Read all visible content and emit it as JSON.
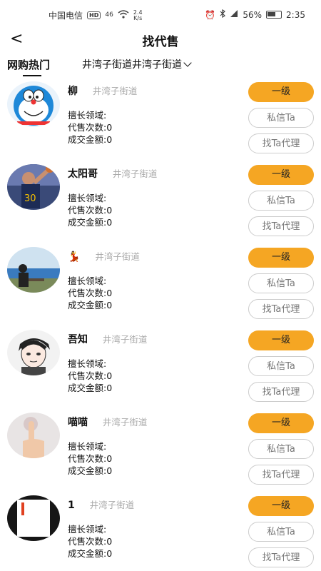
{
  "statusbar": {
    "carrier": "中国电信",
    "hd": "HD",
    "signal": "46",
    "speed_value": "2.4",
    "speed_unit": "K/s",
    "battery": "56%",
    "time": "2:35"
  },
  "header": {
    "back": "<",
    "title": "找代售"
  },
  "tabs": {
    "active": "网购热门",
    "location": "井湾子街道井湾子街道"
  },
  "labels": {
    "expertise": "擅长领域:",
    "count": "代售次数:",
    "amount": "成交金额:",
    "level_button": "一级",
    "message_button": "私信Ta",
    "agent_button": "找Ta代理"
  },
  "agents": [
    {
      "name": "柳",
      "area": "井湾子街道",
      "count": "0",
      "amount": "0",
      "avatar": "doraemon"
    },
    {
      "name": "太阳哥",
      "area": "井湾子街道",
      "count": "0",
      "amount": "0",
      "avatar": "basketball-player"
    },
    {
      "name": "💃",
      "area": "井湾子街道",
      "count": "0",
      "amount": "0",
      "avatar": "seaside-person"
    },
    {
      "name": "吾知",
      "area": "井湾子街道",
      "count": "0",
      "amount": "0",
      "avatar": "anime-boy"
    },
    {
      "name": "喵喵",
      "area": "井湾子街道",
      "count": "0",
      "amount": "0",
      "avatar": "finger-pointing"
    },
    {
      "name": "1",
      "area": "井湾子街道",
      "count": "0",
      "amount": "0",
      "avatar": "dark-frame"
    }
  ],
  "colors": {
    "accent": "#f5a623",
    "muted": "#aaaaaa",
    "border": "#cccccc"
  }
}
